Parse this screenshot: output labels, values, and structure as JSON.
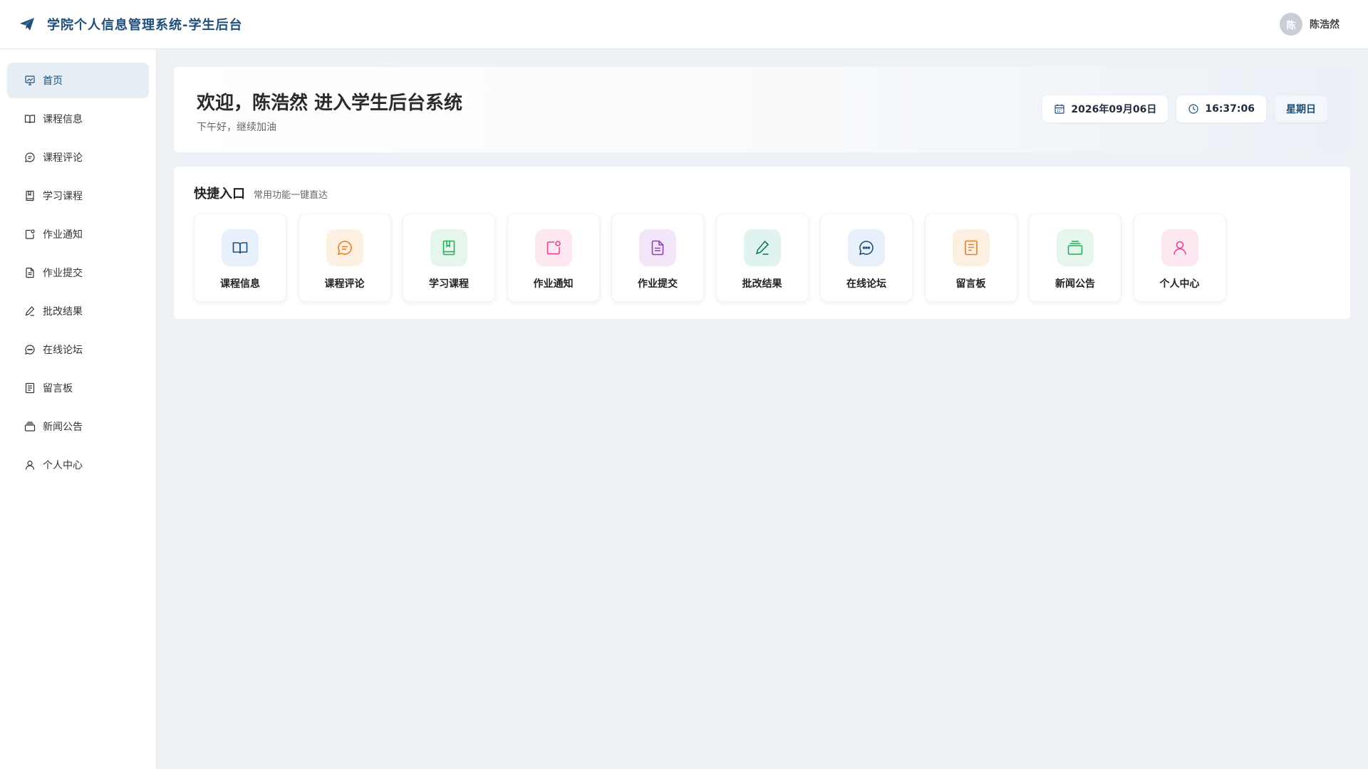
{
  "header": {
    "title": "学院个人信息管理系统-学生后台",
    "brand_icon": "paper-plane-icon",
    "user": {
      "avatar_text": "陈",
      "name": "陈浩然"
    }
  },
  "sidebar": {
    "items": [
      {
        "label": "首页",
        "icon": "presentation-icon",
        "active": true
      },
      {
        "label": "课程信息",
        "icon": "book-open-icon"
      },
      {
        "label": "课程评论",
        "icon": "message-icon"
      },
      {
        "label": "学习课程",
        "icon": "notebook-icon"
      },
      {
        "label": "作业通知",
        "icon": "notification-icon"
      },
      {
        "label": "作业提交",
        "icon": "file-text-icon"
      },
      {
        "label": "批改结果",
        "icon": "pen-icon"
      },
      {
        "label": "在线论坛",
        "icon": "chat-dots-icon"
      },
      {
        "label": "留言板",
        "icon": "note-icon"
      },
      {
        "label": "新闻公告",
        "icon": "news-stack-icon"
      },
      {
        "label": "个人中心",
        "icon": "user-icon"
      }
    ]
  },
  "welcome": {
    "title": "欢迎，陈浩然 进入学生后台系统",
    "subtitle": "下午好，继续加油",
    "date": "2026年09月06日",
    "time": "16:37:06",
    "weekday": "星期日"
  },
  "quick": {
    "title": "快捷入口",
    "subtitle": "常用功能一键直达",
    "cards": [
      {
        "label": "课程信息",
        "icon": "book-open-icon",
        "color": "#1f4e79",
        "bg": "#e8f1fb"
      },
      {
        "label": "课程评论",
        "icon": "message-icon",
        "color": "#e67e22",
        "bg": "#fdf0e3"
      },
      {
        "label": "学习课程",
        "icon": "notebook-icon",
        "color": "#27ae60",
        "bg": "#e6f6ec"
      },
      {
        "label": "作业通知",
        "icon": "notification-icon",
        "color": "#e84393",
        "bg": "#fde7f0"
      },
      {
        "label": "作业提交",
        "icon": "file-text-icon",
        "color": "#8e44ad",
        "bg": "#f3e6f8"
      },
      {
        "label": "批改结果",
        "icon": "pen-icon",
        "color": "#16766a",
        "bg": "#e1f3f0"
      },
      {
        "label": "在线论坛",
        "icon": "chat-dots-icon",
        "color": "#1f4e79",
        "bg": "#e8f1fb"
      },
      {
        "label": "留言板",
        "icon": "note-icon",
        "color": "#e67e22",
        "bg": "#fdf0e3"
      },
      {
        "label": "新闻公告",
        "icon": "news-stack-icon",
        "color": "#27ae60",
        "bg": "#e6f6ec"
      },
      {
        "label": "个人中心",
        "icon": "user-icon",
        "color": "#e84393",
        "bg": "#fde7f0"
      }
    ]
  }
}
